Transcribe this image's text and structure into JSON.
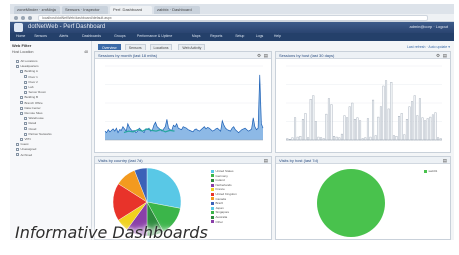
{
  "browser": {
    "tabs": [
      {
        "label": "zoneMinder · zmNinja"
      },
      {
        "label": "Sensors · Inspector"
      },
      {
        "label": "Perf. Dashboard"
      },
      {
        "label": "zabbix · Dashboard"
      }
    ],
    "url": "localhost/dotNetWeb/dashboard/default.aspx"
  },
  "app": {
    "title": "dotNetWeb - Perf Dashboard",
    "user": "admin@corp · Logout"
  },
  "menu": {
    "items": [
      "Home",
      "Sensors",
      "Alerts",
      "Dashboards",
      "Groups",
      "Performance & Uptime",
      "Maps",
      "Reports",
      "Setup",
      "Logs",
      "Help"
    ]
  },
  "sidebar": {
    "title": "Web Filter",
    "subtitle": "Host Location",
    "count": "48",
    "tree": [
      {
        "label": "All Locations",
        "indent": 1
      },
      {
        "label": "Headquarters",
        "indent": 1
      },
      {
        "label": "Building A",
        "indent": 2
      },
      {
        "label": "Floor 1",
        "indent": 3
      },
      {
        "label": "Floor 2",
        "indent": 3
      },
      {
        "label": "Lab",
        "indent": 3
      },
      {
        "label": "Server Room",
        "indent": 3
      },
      {
        "label": "Building B",
        "indent": 2
      },
      {
        "label": "Branch Office",
        "indent": 2
      },
      {
        "label": "Data Center",
        "indent": 2
      },
      {
        "label": "Remote Sites",
        "indent": 2
      },
      {
        "label": "Warehouse",
        "indent": 3
      },
      {
        "label": "Retail",
        "indent": 3
      },
      {
        "label": "Cloud",
        "indent": 3
      },
      {
        "label": "Partner Networks",
        "indent": 3
      },
      {
        "label": "VPN",
        "indent": 2
      },
      {
        "label": "Guest",
        "indent": 1
      },
      {
        "label": "Unassigned",
        "indent": 1
      },
      {
        "label": "Archived",
        "indent": 1
      }
    ]
  },
  "dashboard": {
    "tabs": [
      {
        "label": "Overview",
        "active": true
      },
      {
        "label": "Sensors"
      },
      {
        "label": "Locations"
      },
      {
        "label": "Web Activity"
      }
    ],
    "toolbar_right": "Last refresh · Auto update ▾"
  },
  "panels": {
    "top_left": {
      "title": "Sessions by month (last 18 mths)"
    },
    "top_right": {
      "title": "Sessions by host (last 30 days)"
    },
    "bottom_left": {
      "title": "Visits by country (last 7d)"
    },
    "bottom_right": {
      "title": "Visits by host (last 7d)"
    }
  },
  "chart_data": [
    {
      "type": "area",
      "title": "Sessions by month (last 18 mths)",
      "ylim": [
        0,
        100
      ],
      "series": [
        {
          "values": [
            12,
            10,
            14,
            11,
            13,
            15,
            12,
            16,
            10,
            14,
            13,
            18,
            15,
            12,
            22,
            17,
            14,
            12,
            13,
            10,
            12,
            16,
            14,
            12,
            10,
            15,
            14,
            16,
            12,
            13,
            20,
            24,
            18,
            16,
            14,
            12,
            15,
            18,
            28,
            16,
            14,
            13,
            20,
            18,
            22,
            16,
            15,
            14,
            18,
            17,
            16,
            14,
            13,
            12,
            11,
            14,
            15,
            13,
            12,
            14,
            16,
            18,
            15,
            17,
            16,
            14,
            12,
            13,
            15,
            16,
            14,
            12,
            26,
            20,
            16,
            14,
            13,
            12,
            16,
            18,
            14,
            12,
            10,
            12,
            14,
            15,
            16,
            14,
            12,
            13,
            15,
            30,
            18,
            14,
            16,
            88,
            22,
            16
          ]
        }
      ],
      "overlay": {
        "values": [
          10,
          12,
          11,
          14,
          12,
          15,
          13,
          12,
          14,
          11,
          13,
          12
        ]
      }
    },
    {
      "type": "bar",
      "title": "Sessions by host (last 30 days)",
      "ylim": [
        0,
        100
      ],
      "series": [
        {
          "values": [
            2,
            1,
            3,
            30,
            4,
            5,
            28,
            36,
            3,
            55,
            60,
            25,
            4,
            3,
            2,
            35,
            56,
            48,
            5,
            4,
            3,
            8,
            33,
            30,
            45,
            50,
            28,
            30,
            26,
            2,
            3,
            29,
            4,
            54,
            6,
            31,
            45,
            73,
            80,
            42,
            78,
            6,
            5,
            32,
            36,
            7,
            28,
            45,
            52,
            60,
            33,
            56,
            30,
            26,
            29,
            31,
            34,
            37,
            3,
            2
          ]
        }
      ]
    },
    {
      "type": "pie",
      "title": "Visits by country (last 7d)",
      "slices": [
        {
          "value": 28,
          "color": "#59c8e6"
        },
        {
          "value": 14,
          "color": "#3bb54a"
        },
        {
          "value": 8,
          "color": "#2e8b3e"
        },
        {
          "value": 10,
          "color": "#8a3fa8"
        },
        {
          "value": 6,
          "color": "#f0d21e"
        },
        {
          "value": 18,
          "color": "#e8332a"
        },
        {
          "value": 10,
          "color": "#f39a1f"
        },
        {
          "value": 6,
          "color": "#3b62b8"
        }
      ],
      "legend": [
        "United States",
        "Germany",
        "Ireland",
        "Netherlands",
        "France",
        "United Kingdom",
        "Canada",
        "Brazil",
        "Japan",
        "Singapore",
        "Australia",
        "Other"
      ]
    },
    {
      "type": "pie",
      "title": "Visits by host (last 7d)",
      "slices": [
        {
          "value": 100,
          "color": "#49c24d"
        }
      ],
      "legend": [
        "web01"
      ]
    }
  ],
  "caption": "Informative Dashboards"
}
